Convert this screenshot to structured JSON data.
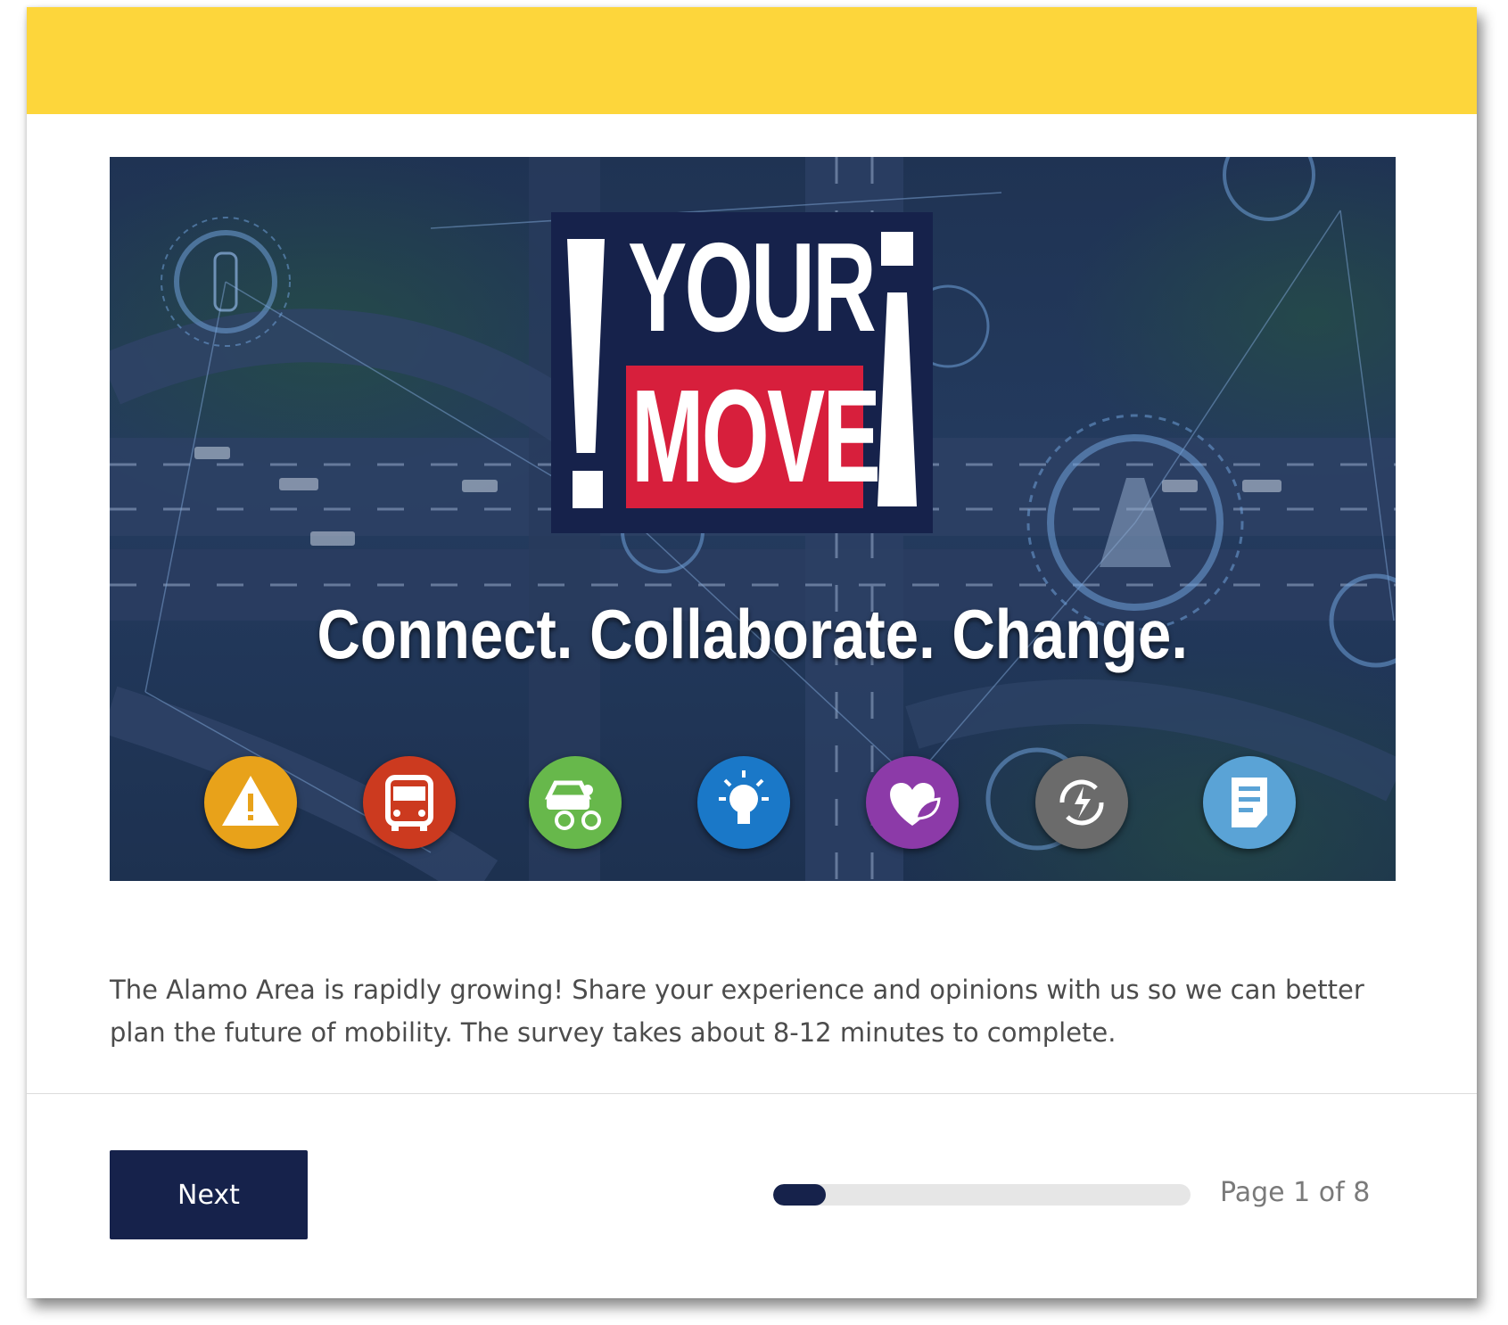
{
  "header": {
    "bar_color": "#fdd63b"
  },
  "banner": {
    "logo": {
      "word1": "YOUR",
      "word2": "MOVE"
    },
    "tagline": "Connect. Collaborate. Change.",
    "icons": [
      {
        "name": "warning-icon",
        "color": "#e8a21a"
      },
      {
        "name": "bus-icon",
        "color": "#cc3a1f"
      },
      {
        "name": "car-bike-icon",
        "color": "#67b84b"
      },
      {
        "name": "lightbulb-icon",
        "color": "#1a78c8"
      },
      {
        "name": "heart-leaf-icon",
        "color": "#8c3aa8"
      },
      {
        "name": "energy-cycle-icon",
        "color": "#6b6b6b"
      },
      {
        "name": "document-icon",
        "color": "#5aa3d6"
      }
    ]
  },
  "intro": {
    "text": "The Alamo Area is rapidly growing! Share your experience and opinions with us so we can better plan the future of mobility. The survey takes about 8-12 minutes to complete."
  },
  "footer": {
    "next_label": "Next",
    "progress": {
      "current_page": 1,
      "total_pages": 8,
      "fraction": 0.125
    },
    "page_indicator": "Page 1 of 8"
  },
  "colors": {
    "navy": "#16224b",
    "accent_red": "#d71f3c"
  }
}
